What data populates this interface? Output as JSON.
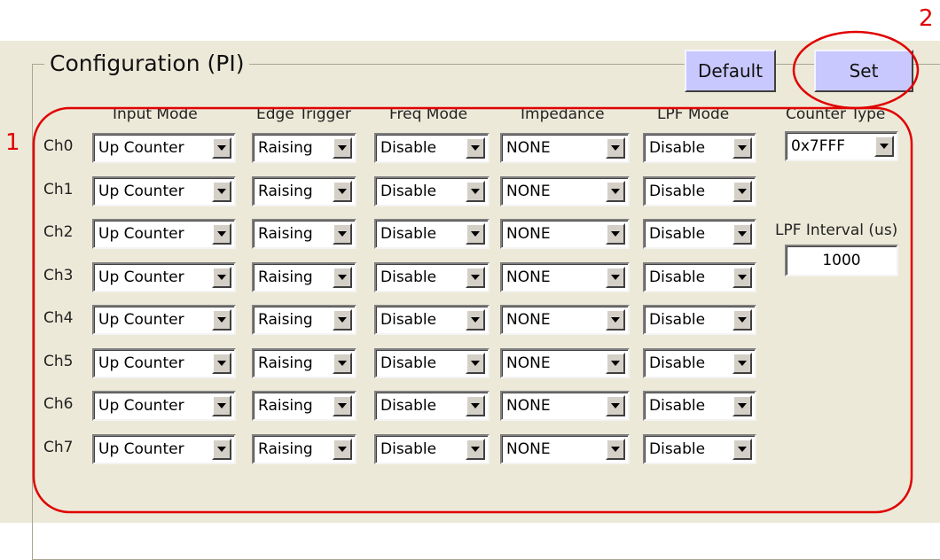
{
  "annotations": {
    "marker_1": "1",
    "marker_2": "2",
    "color": "#e00000"
  },
  "group": {
    "title": "Configuration (PI)"
  },
  "buttons": {
    "default_label": "Default",
    "set_label": "Set",
    "color": "#c8c8ff"
  },
  "columns": {
    "input_mode": "Input Mode",
    "edge_trigger": "Edge Trigger",
    "freq_mode": "Freq Mode",
    "impedance": "Impedance",
    "lpf_mode": "LPF Mode",
    "counter_type": "Counter Type"
  },
  "channels": [
    {
      "label": "Ch0",
      "input_mode": "Up Counter",
      "edge_trigger": "Raising",
      "freq_mode": "Disable",
      "impedance": "NONE",
      "lpf_mode": "Disable"
    },
    {
      "label": "Ch1",
      "input_mode": "Up Counter",
      "edge_trigger": "Raising",
      "freq_mode": "Disable",
      "impedance": "NONE",
      "lpf_mode": "Disable"
    },
    {
      "label": "Ch2",
      "input_mode": "Up Counter",
      "edge_trigger": "Raising",
      "freq_mode": "Disable",
      "impedance": "NONE",
      "lpf_mode": "Disable"
    },
    {
      "label": "Ch3",
      "input_mode": "Up Counter",
      "edge_trigger": "Raising",
      "freq_mode": "Disable",
      "impedance": "NONE",
      "lpf_mode": "Disable"
    },
    {
      "label": "Ch4",
      "input_mode": "Up Counter",
      "edge_trigger": "Raising",
      "freq_mode": "Disable",
      "impedance": "NONE",
      "lpf_mode": "Disable"
    },
    {
      "label": "Ch5",
      "input_mode": "Up Counter",
      "edge_trigger": "Raising",
      "freq_mode": "Disable",
      "impedance": "NONE",
      "lpf_mode": "Disable"
    },
    {
      "label": "Ch6",
      "input_mode": "Up Counter",
      "edge_trigger": "Raising",
      "freq_mode": "Disable",
      "impedance": "NONE",
      "lpf_mode": "Disable"
    },
    {
      "label": "Ch7",
      "input_mode": "Up Counter",
      "edge_trigger": "Raising",
      "freq_mode": "Disable",
      "impedance": "NONE",
      "lpf_mode": "Disable"
    }
  ],
  "counter_type": {
    "value": "0x7FFF"
  },
  "lpf_interval": {
    "label": "LPF Interval (us)",
    "value": "1000"
  },
  "icons": {
    "dropdown": "chevron-down-icon"
  }
}
